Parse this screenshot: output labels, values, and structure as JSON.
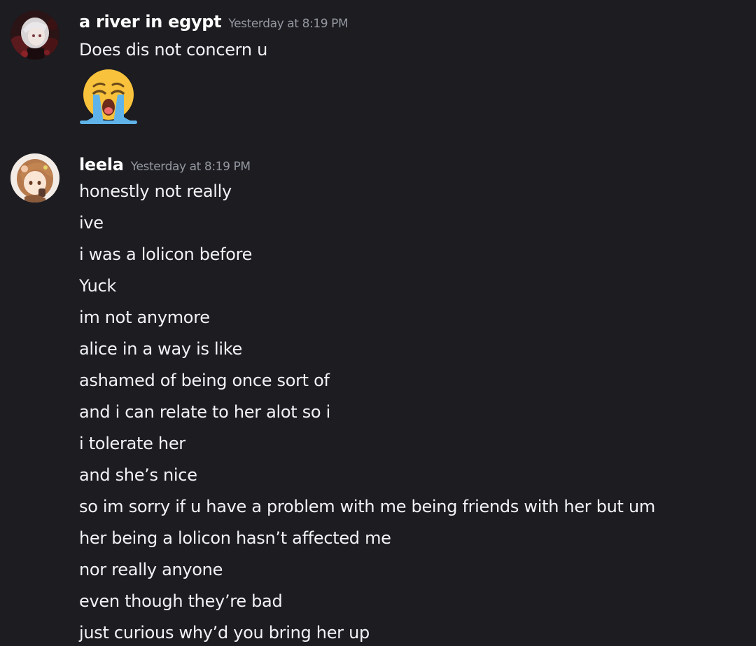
{
  "messages": [
    {
      "username": "a river in egypt",
      "timestamp": "Yesterday at 8:19 PM",
      "avatar_icon": "anime-avatar-white-hair",
      "lines": [
        "Does dis not concern u"
      ],
      "emoji": "loudly-crying-face"
    },
    {
      "username": "leela",
      "timestamp": "Yesterday at 8:19 PM",
      "avatar_icon": "anime-avatar-brown-hair",
      "lines": [
        "honestly not really",
        "ive",
        "i was a lolicon before",
        "Yuck",
        "im not anymore",
        "alice in a way  is like",
        "ashamed of being once sort of",
        "and i can relate to her alot so i",
        "i tolerate her",
        "and she’s nice",
        "so im sorry if u have a problem with me being friends with her but um",
        "her being a lolicon hasn’t affected me",
        "nor really anyone",
        "even though they’re bad",
        "just curious why’d you bring her up"
      ]
    }
  ]
}
